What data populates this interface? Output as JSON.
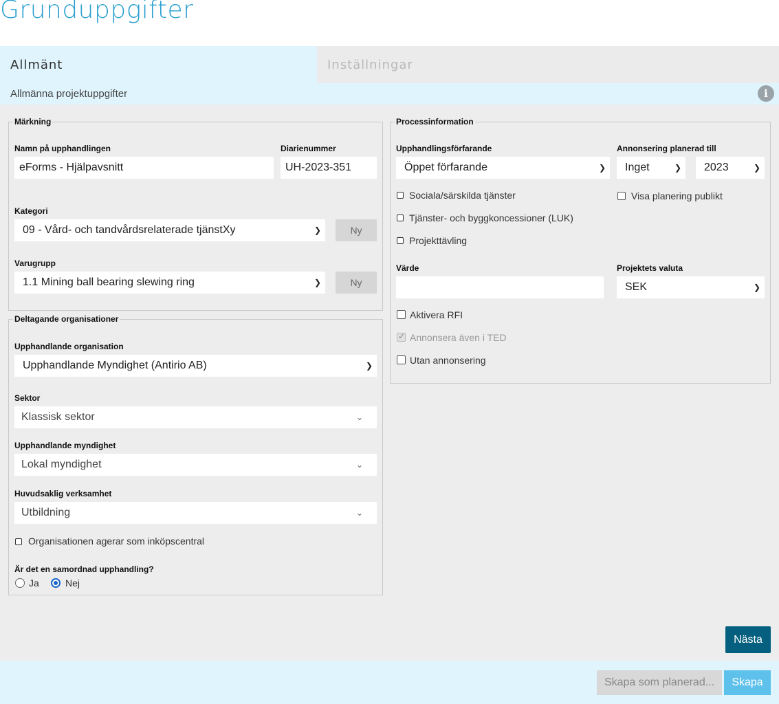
{
  "page": {
    "title": "Grunduppgifter"
  },
  "tabs": [
    {
      "label": "Allmänt",
      "active": true
    },
    {
      "label": "Inställningar",
      "active": false
    }
  ],
  "subheader": {
    "title": "Allmänna projektuppgifter",
    "info_icon": "info-icon"
  },
  "marking": {
    "legend": "Märkning",
    "name_label": "Namn på upphandlingen",
    "name_value": "eForms - Hjälpavsnitt",
    "diary_label": "Diarienummer",
    "diary_value": "UH-2023-351",
    "category_label": "Kategori",
    "category_value": "09 - Vård- och tandvårdsrelaterade tjänstXy",
    "category_new": "Ny",
    "group_label": "Varugrupp",
    "group_value": "1.1 Mining ball bearing slewing ring",
    "group_new": "Ny"
  },
  "orgs": {
    "legend": "Deltagande organisationer",
    "contracting_org_label": "Upphandlande organisation",
    "contracting_org_value": "Upphandlande Myndighet (Antirio AB)",
    "sector_label": "Sektor",
    "sector_value": "Klassisk sektor",
    "authority_label": "Upphandlande myndighet",
    "authority_value": "Lokal myndighet",
    "activity_label": "Huvudsaklig verksamhet",
    "activity_value": "Utbildning",
    "central_purchasing_label": "Organisationen agerar som inköpscentral",
    "central_purchasing_checked": false,
    "coordinated_question": "Är det en samordnad upphandling?",
    "coordinated_options": [
      "Ja",
      "Nej"
    ],
    "coordinated_selected": "Nej"
  },
  "process": {
    "legend": "Processinformation",
    "procedure_label": "Upphandlingsförfarande",
    "procedure_value": "Öppet förfarande",
    "announcement_label": "Annonsering planerad till",
    "announcement_period": "Inget",
    "announcement_year": "2023",
    "social_services_label": "Sociala/särskilda tjänster",
    "concessions_label": "Tjänster- och byggkoncessioner (LUK)",
    "design_contest_label": "Projekttävling",
    "show_public_label": "Visa planering publikt",
    "value_label": "Värde",
    "value_value": "",
    "currency_label": "Projektets valuta",
    "currency_value": "SEK",
    "activate_rfi_label": "Aktivera RFI",
    "announce_ted_label": "Annonsera även i TED",
    "announce_ted_checked": true,
    "no_announcement_label": "Utan annonsering"
  },
  "actions": {
    "next": "Nästa",
    "create_planned": "Skapa som planerad...",
    "create": "Skapa"
  },
  "colors": {
    "title": "#2a9fd0",
    "tab_active_bg": "#dff4fc",
    "primary_button": "#05607f",
    "create_button": "#5ec1ec"
  }
}
